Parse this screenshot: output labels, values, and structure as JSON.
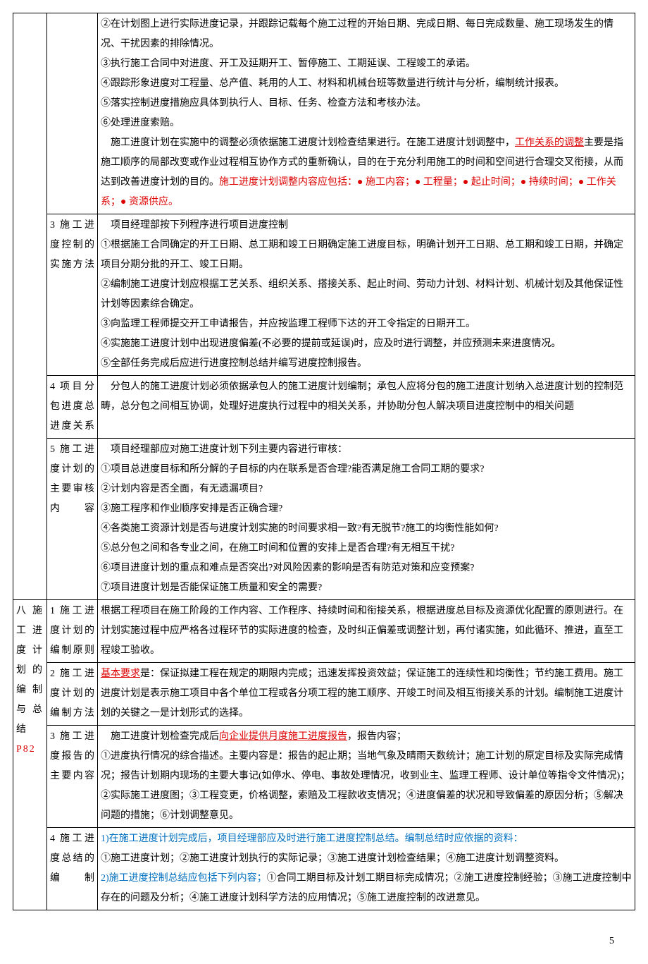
{
  "pageNumber": "5",
  "row0": {
    "c1": "",
    "c2": "",
    "p0": "②在计划图上进行实际进度记录，并跟踪记载每个施工过程的开始日期、完成日期、每日完成数量、施工现场发生的情况、干扰因素的排除情况。",
    "p1": "③执行施工合同中对进度、开工及延期开工、暂停施工、工期延误、工程竣工的承诺。",
    "p2": "④跟踪形象进度对工程量、总产值、耗用的人工、材料和机械台班等数量进行统计与分析，编制统计报表。",
    "p3": "⑤落实控制进度措施应具体到执行人、目标、任务、检查方法和考核办法。",
    "p4": "⑥处理进度索赔。",
    "p5a": "　施工进度计划在实施中的调整必须依据施工进度计划检查结果进行。在施工进度计划调整中，",
    "p5b": "工作关系的调整",
    "p5c": "主要是指施工顺序的局部改变或作业过程相互协作方式的重新确认，目的在于充分利用施工的时间和空间进行合理交叉衔接，从而达到改善进度计划的目的。",
    "p5d": "施工进度计划调整内容应包括：● 施工内容；● 工程量；● 起止时间；● 持续时间；● 工作关系；● 资源供应。"
  },
  "row1": {
    "c2": "3 施工进度控制的实施方法",
    "p0": "　项目经理部按下列程序进行项目进度控制",
    "p1": "①根据施工合同确定的开工日期、总工期和竣工日期确定施工进度目标，明确计划开工日期、总工期和竣工日期，并确定项目分期分批的开工、竣工日期。",
    "p2": "②编制施工进度计划应根据工艺关系、组织关系、搭接关系、起止时间、劳动力计划、材料计划、机械计划及其他保证性计划等因素综合确定。",
    "p3": "③向监理工程师提交开工申请报告，并应按监理工程师下达的开工令指定的日期开工。",
    "p4": "④实施施工进度计划中出现进度偏差(不必要的提前或延误)时，应及时进行调整，并应预测未来进度情况。",
    "p5": "⑤全部任务完成后应进行进度控制总结并编写进度控制报告。"
  },
  "row2": {
    "c2": "4 项目分包进度总进度关系",
    "p0": "　分包人的施工进度计划必须依据承包人的施工进度计划编制；承包人应将分包的施工进度计划纳入总进度计划的控制范畴，总分包之间相互协调，处理好进度执行过程中的相关关系，并协助分包人解决项目进度控制中的相关问题"
  },
  "row3": {
    "c2": "5 施工进度计划的主要审核内容",
    "p0": "　项目经理部应对施工进度计划下列主要内容进行审核：",
    "p1": "①项目总进度目标和所分解的子目标的内在联系是否合理?能否满足施工合同工期的要求?",
    "p2": "②计划内容是否全面，有无遗漏项目?",
    "p3": "③施工程序和作业顺序安排是否正确合理?",
    "p4": "④各类施工资源计划是否与进度计划实施的时间要求相一致?有无脱节?施工的均衡性能如何?",
    "p5": "⑤总分包之间和各专业之间，在施工时间和位置的安排上是否合理?有无相互干扰?",
    "p6": "⑥项目进度计划的重点和难点是否突出?对风险因素的影响是否有防范对策和应变预案?",
    "p7": "⑦项目进度计划是否能保证施工质量和安全的需要?"
  },
  "col1Labels": {
    "a": "八 施工进度计划的编制与总结",
    "b": "P82"
  },
  "row4": {
    "c2": "1 施工进度计划的编制原则",
    "p0": "根据工程项目在施工阶段的工作内容、工作程序、持续时间和衔接关系，根据进度总目标及资源优化配置的原则进行。在计划实施过程中应严格各过程环节的实际进度的检查，及时纠正偏差或调整计划，再付诸实施，如此循环、推进，直至工程竣工验收。"
  },
  "row5": {
    "c2": "2 施工进度计划的编制方法",
    "p0a": "基本要求",
    "p0b": "是：保证拟建工程在规定的期限内完成；迅速发挥投资效益；保证施工的连续性和均衡性；节约施工费用。施工进度计划是表示施工项目中各个单位工程或各分项工程的施工顺序、开竣工时间及相互衔接关系的计划。编制施工进度计划的关键之一是计划形式的选择。"
  },
  "row6": {
    "c2": "3 施工进度报告的主要内容",
    "p0a": "　施工进度计划检查完成后",
    "p0b": "向企业提供月度施工进度报告",
    "p0c": "，报告内容；",
    "p1": "①进度执行情况的综合描述。主要内容是：报告的起止期；当地气象及晴雨天数统计；施工计划的原定目标及实际完成情况；报告计划期内现场的主要大事记(如停水、停电、事故处理情况，收到业主、监理工程师、设计单位等指令文件情况)；②实际施工进度图；③工程变更，价格调整，索赔及工程款收支情况；④进度偏差的状况和导致偏差的原因分析；⑤解决问题的措施；⑥计划调整意见。"
  },
  "row7": {
    "c2": "4 施工进度总结的编制",
    "p0": "1)在施工进度计划完成后，项目经理部应及时进行施工进度控制总结。编制总结时应依据的资料：",
    "p1": "①施工进度计划；②施工进度计划执行的实际记录；③施工进度计划检查结果；④施工进度计划调整资料。",
    "p2a": "2)施工进度控制总结应包括下列内容；",
    "p2b": "①合同工期目标及计划工期目标完成情况；②施工进度控制经验；③施工进度控制中存在的问题及分析；④施工进度计划科学方法的应用情况；⑤施工进度控制的改进意见。"
  }
}
